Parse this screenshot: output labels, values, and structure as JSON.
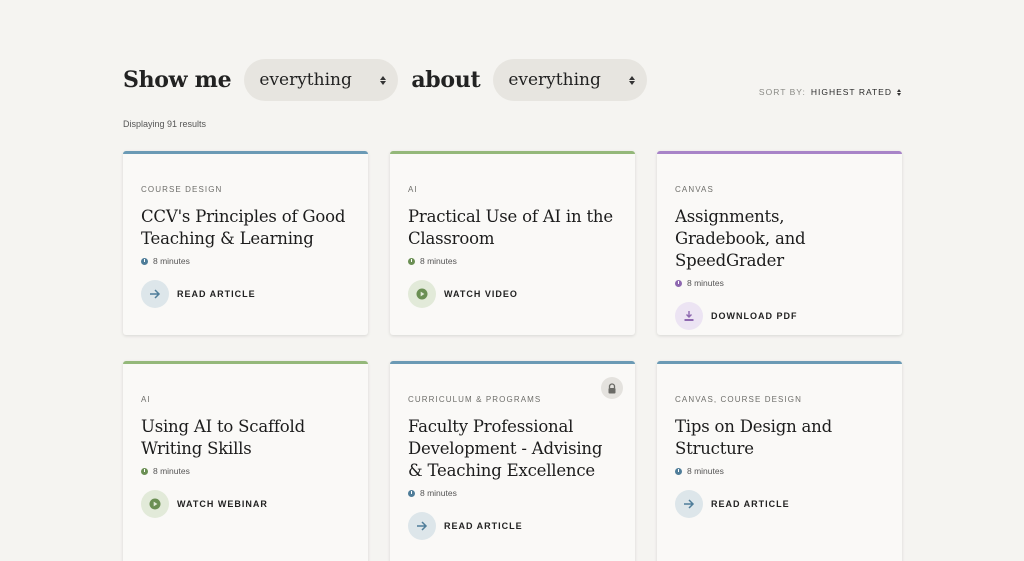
{
  "filters": {
    "show_me_label": "Show me",
    "type_value": "everything",
    "about_label": "about",
    "topic_value": "everything"
  },
  "sort": {
    "label": "SORT BY:",
    "value": "HIGHEST RATED"
  },
  "results_text": "Displaying 91 results",
  "colors": {
    "design_blue": "#6b9ab5",
    "ai_green": "#94b87a",
    "canvas_purple": "#a884c8"
  },
  "cards": [
    {
      "category": "COURSE DESIGN",
      "title": "CCV's Principles of Good Teaching & Learning",
      "duration": "8 minutes",
      "action": "READ ARTICLE",
      "action_icon": "arrow-right-icon",
      "locked": false
    },
    {
      "category": "AI",
      "title": "Practical Use of AI in the Classroom",
      "duration": "8 minutes",
      "action": "WATCH VIDEO",
      "action_icon": "play-icon",
      "locked": false
    },
    {
      "category": "CANVAS",
      "title": "Assignments, Gradebook, and SpeedGrader",
      "duration": "8 minutes",
      "action": "DOWNLOAD PDF",
      "action_icon": "download-icon",
      "locked": false
    },
    {
      "category": "AI",
      "title": "Using AI to Scaffold Writing Skills",
      "duration": "8 minutes",
      "action": "WATCH WEBINAR",
      "action_icon": "play-icon",
      "locked": false
    },
    {
      "category": "CURRICULUM & PROGRAMS",
      "title": "Faculty Professional Development - Advising & Teaching Excellence",
      "duration": "8 minutes",
      "action": "READ ARTICLE",
      "action_icon": "arrow-right-icon",
      "locked": true
    },
    {
      "category": "CANVAS, COURSE DESIGN",
      "title": "Tips on Design and Structure",
      "duration": "8 minutes",
      "action": "READ ARTICLE",
      "action_icon": "arrow-right-icon",
      "locked": false
    }
  ]
}
